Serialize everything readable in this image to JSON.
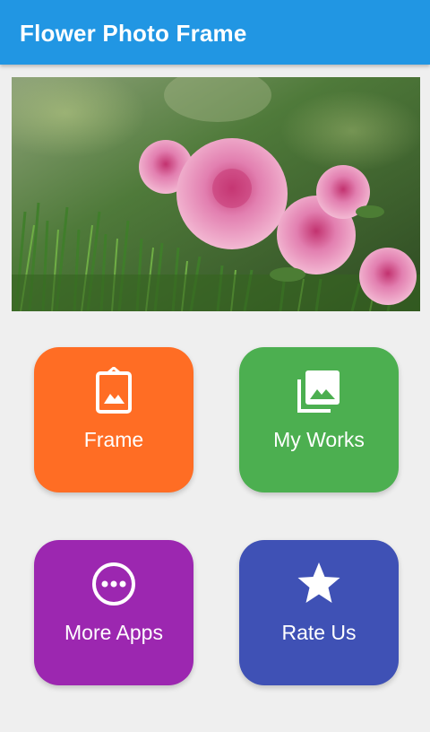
{
  "app_bar": {
    "title": "Flower Photo Frame",
    "color": "#2196e3"
  },
  "banner": {
    "subject": "pink roses on green grass"
  },
  "tiles": [
    {
      "id": "frame",
      "label": "Frame",
      "icon": "frame-photo-icon",
      "color": "#ff6d24"
    },
    {
      "id": "works",
      "label": "My Works",
      "icon": "photo-library-icon",
      "color": "#4caf50"
    },
    {
      "id": "more",
      "label": "More Apps",
      "icon": "more-circle-icon",
      "color": "#9c27b0"
    },
    {
      "id": "rate",
      "label": "Rate Us",
      "icon": "star-icon",
      "color": "#3f51b5"
    }
  ]
}
